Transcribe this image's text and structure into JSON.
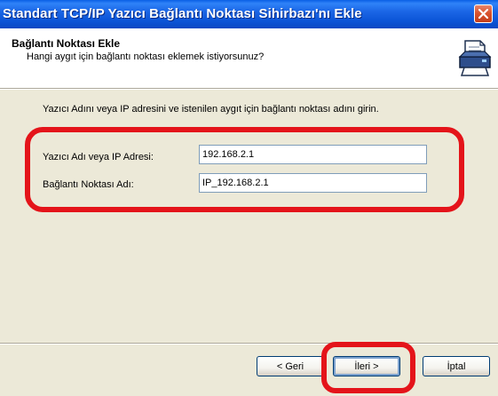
{
  "window": {
    "title": "Standart TCP/IP Yazıcı Bağlantı Noktası Sihirbazı'nı Ekle"
  },
  "header": {
    "title": "Bağlantı Noktası Ekle",
    "subtitle": "Hangi aygıt için bağlantı noktası eklemek istiyorsunuz?"
  },
  "main": {
    "instruction": "Yazıcı Adını veya IP adresini ve istenilen aygıt için bağlantı noktası adını girin.",
    "printer_label": "Yazıcı Adı veya IP Adresi:",
    "printer_value": "192.168.2.1",
    "port_label": "Bağlantı Noktası Adı:",
    "port_value": "IP_192.168.2.1"
  },
  "buttons": {
    "back": "< Geri",
    "next": "İleri >",
    "cancel": "İptal"
  },
  "colors": {
    "highlight": "#E4141A",
    "titlebar": "#0B54D6"
  },
  "icons": {
    "close": "close-icon",
    "printer": "printer-icon"
  }
}
